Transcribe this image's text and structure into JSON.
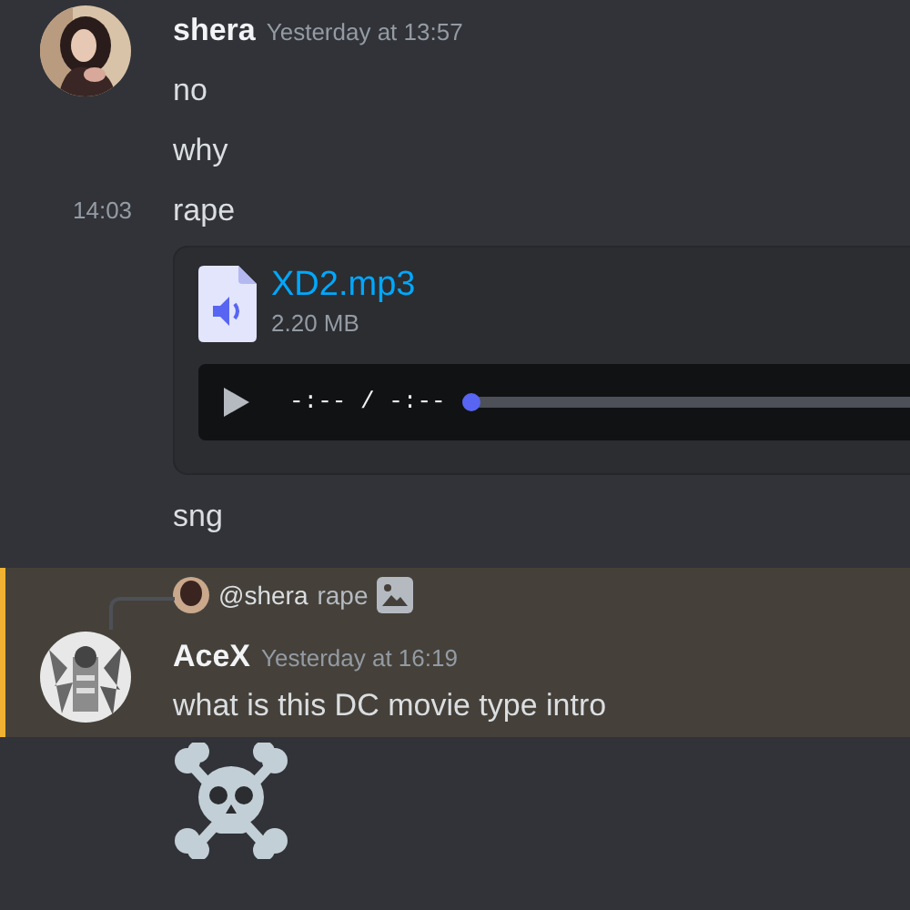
{
  "messages": [
    {
      "kind": "header",
      "author": "shera",
      "timestamp": "Yesterday at 13:57"
    },
    {
      "kind": "text",
      "text": "no"
    },
    {
      "kind": "text",
      "text": "why"
    },
    {
      "kind": "text",
      "hover_time": "14:03",
      "text": "rape"
    },
    {
      "kind": "attachment",
      "file_name": "XD2.mp3",
      "file_size": "2.20 MB",
      "player_time": "-:-- / -:--",
      "level": 0
    },
    {
      "kind": "text",
      "text": "sng"
    },
    {
      "kind": "reply_group",
      "highlighted": true,
      "reply": {
        "mention": "@shera",
        "preview": "rape"
      },
      "author": "AceX",
      "timestamp": "Yesterday at 16:19",
      "text": "what is this DC movie type intro"
    },
    {
      "kind": "emoji"
    }
  ]
}
